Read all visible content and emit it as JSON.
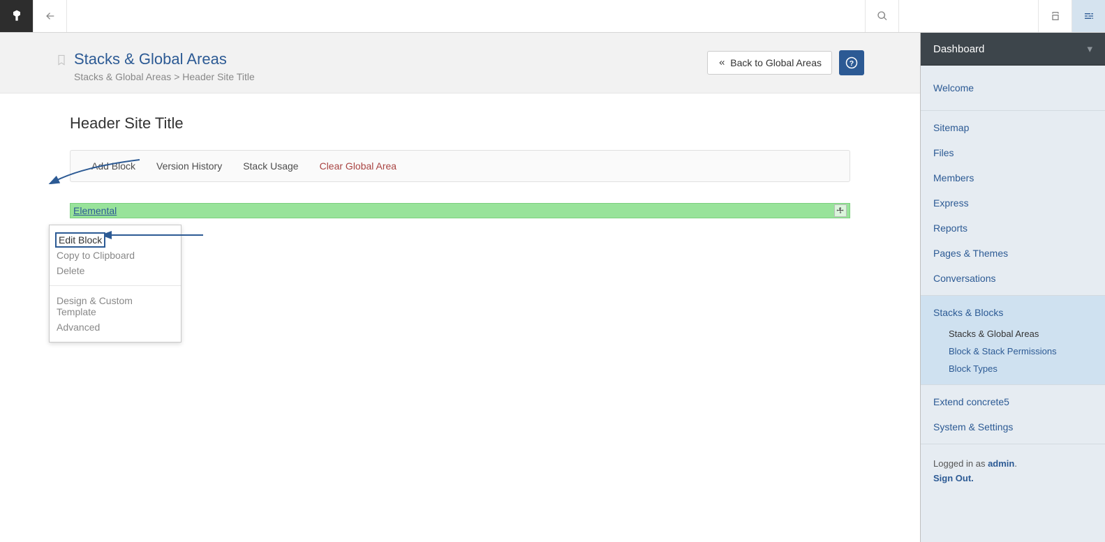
{
  "toolbar": {
    "back_title": "Back",
    "search_placeholder": "Search"
  },
  "header": {
    "title": "Stacks & Global Areas",
    "breadcrumb_root": "Stacks & Global Areas",
    "breadcrumb_sep": ">",
    "breadcrumb_current": "Header Site Title",
    "back_button": "Back to Global Areas",
    "help_label": "?"
  },
  "body": {
    "stack_title": "Header Site Title",
    "actions": {
      "add_block": "Add Block",
      "version_history": "Version History",
      "stack_usage": "Stack Usage",
      "clear_global_area": "Clear Global Area"
    },
    "block_label": "Elemental"
  },
  "context_menu": {
    "edit_block": "Edit Block",
    "copy_clipboard": "Copy to Clipboard",
    "delete": "Delete",
    "design_template": "Design & Custom Template",
    "advanced": "Advanced"
  },
  "dashboard": {
    "title": "Dashboard",
    "welcome": "Welcome",
    "nav": {
      "sitemap": "Sitemap",
      "files": "Files",
      "members": "Members",
      "express": "Express",
      "reports": "Reports",
      "pages_themes": "Pages & Themes",
      "conversations": "Conversations",
      "stacks_blocks": "Stacks & Blocks",
      "stacks_global_areas": "Stacks & Global Areas",
      "block_stack_permissions": "Block & Stack Permissions",
      "block_types": "Block Types",
      "extend": "Extend concrete5",
      "system_settings": "System & Settings"
    },
    "footer": {
      "logged_in_as_prefix": "Logged in as ",
      "admin_name": "admin",
      "suffix": ".",
      "sign_out": "Sign Out."
    }
  }
}
